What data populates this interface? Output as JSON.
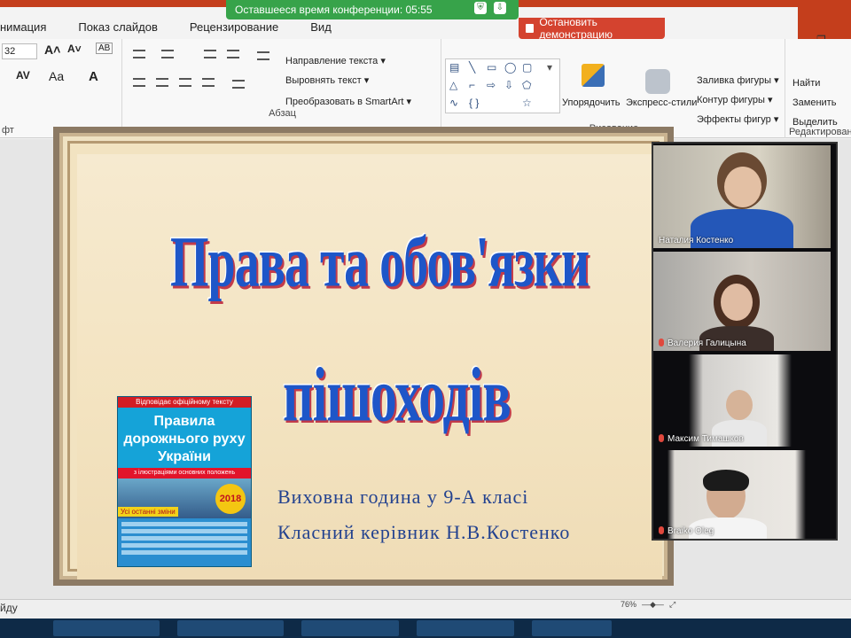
{
  "ribbon_tabs": [
    "нимация",
    "Показ слайдов",
    "Рецензирование",
    "Вид"
  ],
  "conference": {
    "timer_text": "Оставшееся время конференции: 05:55",
    "stop_label": "Остановить демонстрацию"
  },
  "ribbon": {
    "font_size": "32",
    "font_group_label": "фт",
    "paragraph": {
      "label": "Абзац",
      "text_direction": "Направление текста",
      "align_text": "Выровнять текст",
      "smartart": "Преобразовать в SmartArt"
    },
    "drawing": {
      "label": "Рисование",
      "arrange": "Упорядочить",
      "quick_styles": "Экспресс-стили",
      "shape_fill": "Заливка фигуры",
      "shape_outline": "Контур фигуры",
      "shape_effects": "Эффекты фигур"
    },
    "editing": {
      "label": "Редактирование",
      "find": "Найти",
      "replace": "Заменить",
      "select": "Выделить"
    }
  },
  "slide": {
    "title_line1": "Права та обов'язки",
    "title_line2": "пішоходів",
    "subtitle1": "Виховна година у 9-А класі",
    "subtitle2": "Класний керівник Н.В.Костенко",
    "book": {
      "top_note": "Відповідає офіційному тексту",
      "title": "Правила дорожнього руху України",
      "band": "з ілюстраціями основних положень",
      "year": "2018",
      "tag": "Усі останні зміни"
    }
  },
  "participants": [
    {
      "name": "Наталия Костенко",
      "muted": false
    },
    {
      "name": "Валерия Галицына",
      "muted": true
    },
    {
      "name": "Максим Тимашков",
      "muted": true
    },
    {
      "name": "Braiko Oleg",
      "muted": true
    }
  ],
  "status": {
    "left_text": "йду",
    "zoom": "76%"
  }
}
